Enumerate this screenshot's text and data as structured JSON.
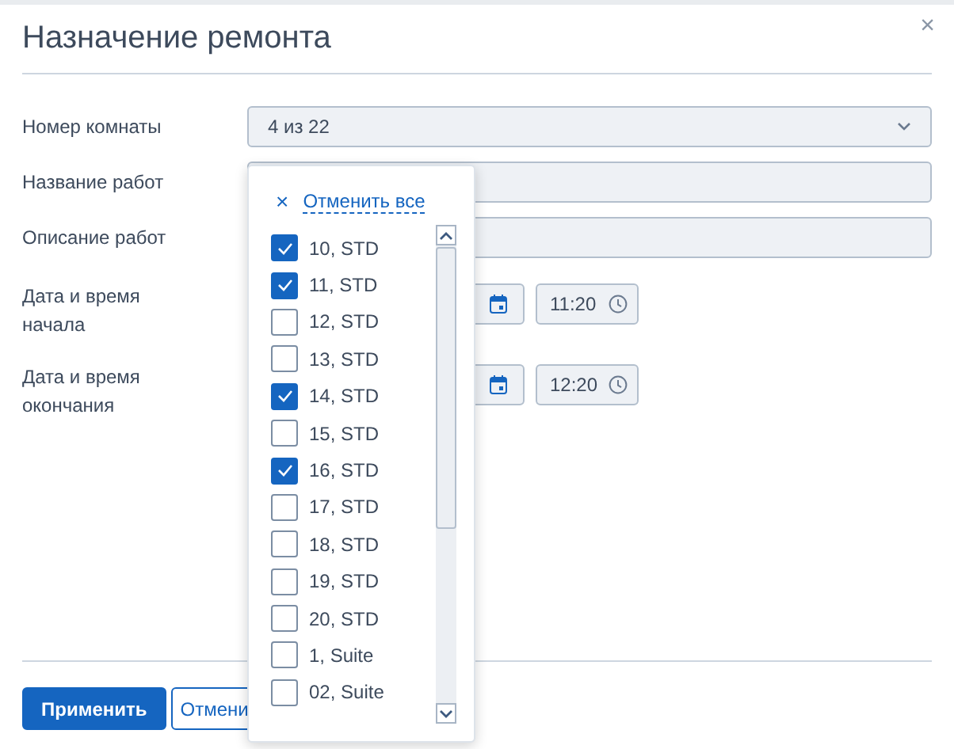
{
  "dialog": {
    "title": "Назначение ремонта",
    "close": "×"
  },
  "form": [
    {
      "kind": "select",
      "label": "Номер комнаты",
      "value": "4 из 22"
    },
    {
      "kind": "text",
      "label": "Название работ"
    },
    {
      "kind": "text",
      "label": "Описание работ"
    },
    {
      "kind": "datetime",
      "label": "Дата и время начала",
      "time": "11:20"
    },
    {
      "kind": "datetime",
      "label": "Дата и время окончания",
      "time": "12:20"
    }
  ],
  "dropdown": {
    "clear_icon": "×",
    "clear_label": "Отменить все",
    "options": [
      {
        "label": "10, STD",
        "checked": true
      },
      {
        "label": "11, STD",
        "checked": true
      },
      {
        "label": "12, STD",
        "checked": false
      },
      {
        "label": "13, STD",
        "checked": false
      },
      {
        "label": "14, STD",
        "checked": true
      },
      {
        "label": "15, STD",
        "checked": false
      },
      {
        "label": "16, STD",
        "checked": true
      },
      {
        "label": "17, STD",
        "checked": false
      },
      {
        "label": "18, STD",
        "checked": false
      },
      {
        "label": "19, STD",
        "checked": false
      },
      {
        "label": "20, STD",
        "checked": false
      },
      {
        "label": "1, Suite",
        "checked": false
      },
      {
        "label": "02, Suite",
        "checked": false
      }
    ]
  },
  "buttons": [
    {
      "kind": "primary",
      "label": "Применить"
    },
    {
      "kind": "secondary",
      "label": "Отмени"
    }
  ]
}
